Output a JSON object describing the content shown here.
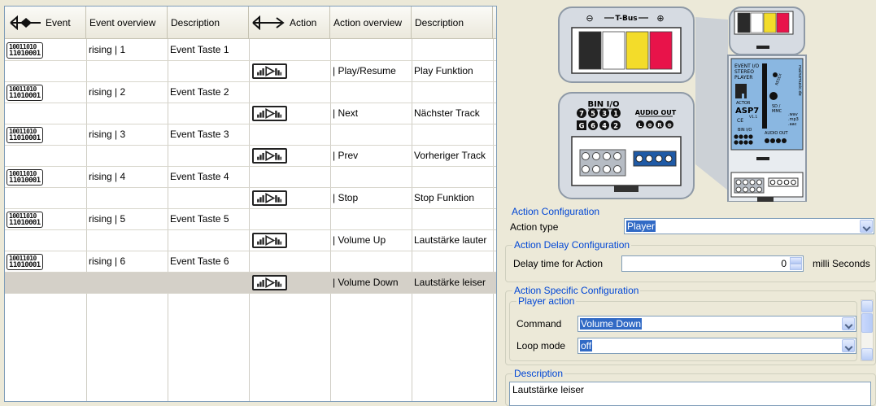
{
  "grid": {
    "headers": {
      "event": "Event",
      "event_overview": "Event overview",
      "description1": "Description",
      "action": "Action",
      "action_overview": "Action overview",
      "description2": "Description"
    },
    "event_icon_text": [
      "10011010",
      "11010001"
    ],
    "rows": [
      {
        "kind": "event",
        "overview": "rising | 1",
        "description": "Event Taste 1"
      },
      {
        "kind": "action",
        "overview": "| Play/Resume",
        "description": "Play Funktion"
      },
      {
        "kind": "event",
        "overview": "rising | 2",
        "description": "Event Taste 2"
      },
      {
        "kind": "action",
        "overview": "| Next",
        "description": "Nächster Track"
      },
      {
        "kind": "event",
        "overview": "rising | 3",
        "description": "Event Taste 3"
      },
      {
        "kind": "action",
        "overview": "| Prev",
        "description": "Vorheriger Track"
      },
      {
        "kind": "event",
        "overview": "rising | 4",
        "description": "Event Taste 4"
      },
      {
        "kind": "action",
        "overview": "| Stop",
        "description": "Stop Funktion"
      },
      {
        "kind": "event",
        "overview": "rising | 5",
        "description": "Event Taste 5"
      },
      {
        "kind": "action",
        "overview": "| Volume Up",
        "description": "Lautstärke lauter"
      },
      {
        "kind": "event",
        "overview": "rising | 6",
        "description": "Event Taste 6"
      },
      {
        "kind": "action",
        "overview": "| Volume Down",
        "description": "Lautstärke leiser",
        "selected": true
      }
    ]
  },
  "device": {
    "tbus_label": "T-Bus",
    "tbus_minus": "⊖",
    "tbus_plus": "⊕",
    "bin_io_label": "BIN I/O",
    "audio_out_label": "AUDIO OUT",
    "bin_top": [
      "7",
      "5",
      "3",
      "1"
    ],
    "bin_bottom": [
      "G",
      "6",
      "4",
      "2"
    ],
    "audio_symbols": [
      "L",
      "⊕",
      "R",
      "⊕"
    ],
    "colors": [
      "#2a2a2a",
      "#ffffff",
      "#f3dc2a",
      "#e8134a"
    ],
    "module": {
      "title_lines": [
        "EVENT I/O",
        "STEREO",
        "PLAYER"
      ],
      "actor": "ACTOR",
      "model": "ASP7",
      "version": "V1.1",
      "ce": "CE",
      "brand": "mainzmusic.de",
      "reset": "RESEX",
      "sd": "SD /",
      "mmc": "MMC",
      "formats": [
        ".wav",
        ".mp3",
        ".aac"
      ],
      "bin_io": "BIN I/O",
      "audio_out": "AUDIO OUT"
    }
  },
  "config": {
    "action_configuration": {
      "legend": "Action Configuration",
      "action_type_label": "Action type",
      "action_type_value": "Player"
    },
    "delay": {
      "legend": "Action Delay Configuration",
      "label": "Delay time for Action",
      "value": "0",
      "unit": "milli Seconds"
    },
    "specific": {
      "legend": "Action Specific Configuration",
      "player_legend": "Player action",
      "command_label": "Command",
      "command_value": "Volume Down",
      "loop_label": "Loop mode",
      "loop_value": "off"
    },
    "description": {
      "legend": "Description",
      "value": "Lautstärke leiser"
    }
  }
}
